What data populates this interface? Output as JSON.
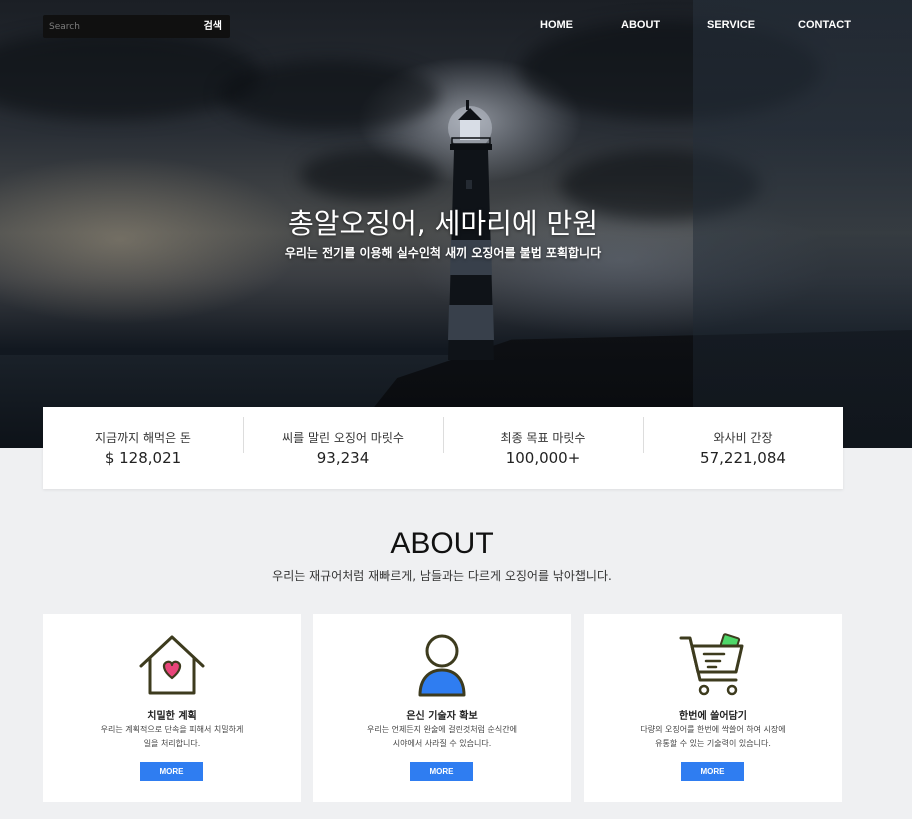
{
  "search": {
    "placeholder": "Search",
    "button_label": "검색"
  },
  "nav": {
    "items": [
      "HOME",
      "ABOUT",
      "SERVICE",
      "CONTACT"
    ]
  },
  "hero": {
    "title": "총알오징어, 세마리에 만원",
    "subtitle": "우리는 전기를 이용해 실수인척 새끼 오징어를 불법 포획합니다"
  },
  "stats": [
    {
      "label": "지금까지 해먹은 돈",
      "value": "$ 128,021"
    },
    {
      "label": "씨를 말린 오징어 마릿수",
      "value": "93,234"
    },
    {
      "label": "최종 목표 마릿수",
      "value": "100,000+"
    },
    {
      "label": "와사비 간장",
      "value": "57,221,084"
    }
  ],
  "about": {
    "title": "ABOUT",
    "description": "우리는 재규어처럼 재빠르게, 남들과는 다르게 오징어를 낚아챕니다."
  },
  "cards": [
    {
      "icon": "house-heart-icon",
      "title": "치밀한 계획",
      "desc_line1": "우리는 계획적으로 단속을 피해서 치밀하게",
      "desc_line2": "일을 처리합니다.",
      "button": "MORE"
    },
    {
      "icon": "person-icon",
      "title": "은신 기술자 확보",
      "desc_line1": "우리는 언제든지 완술에 걸린것처럼 순식간에",
      "desc_line2": "시야에서 사라질 수 있습니다.",
      "button": "MORE"
    },
    {
      "icon": "shopping-cart-icon",
      "title": "한번에 쓸어담기",
      "desc_line1": "다량의 오징어를 한번에 싹쓸어 하여 시장에",
      "desc_line2": "유통할 수 있는 기술력이 있습니다.",
      "button": "MORE"
    }
  ],
  "colors": {
    "accent": "#2f7df1",
    "icon_stroke": "#3d3b1e",
    "heart": "#e8457a",
    "person_fill": "#2f7df1",
    "cart_card": "#4fd86a"
  }
}
